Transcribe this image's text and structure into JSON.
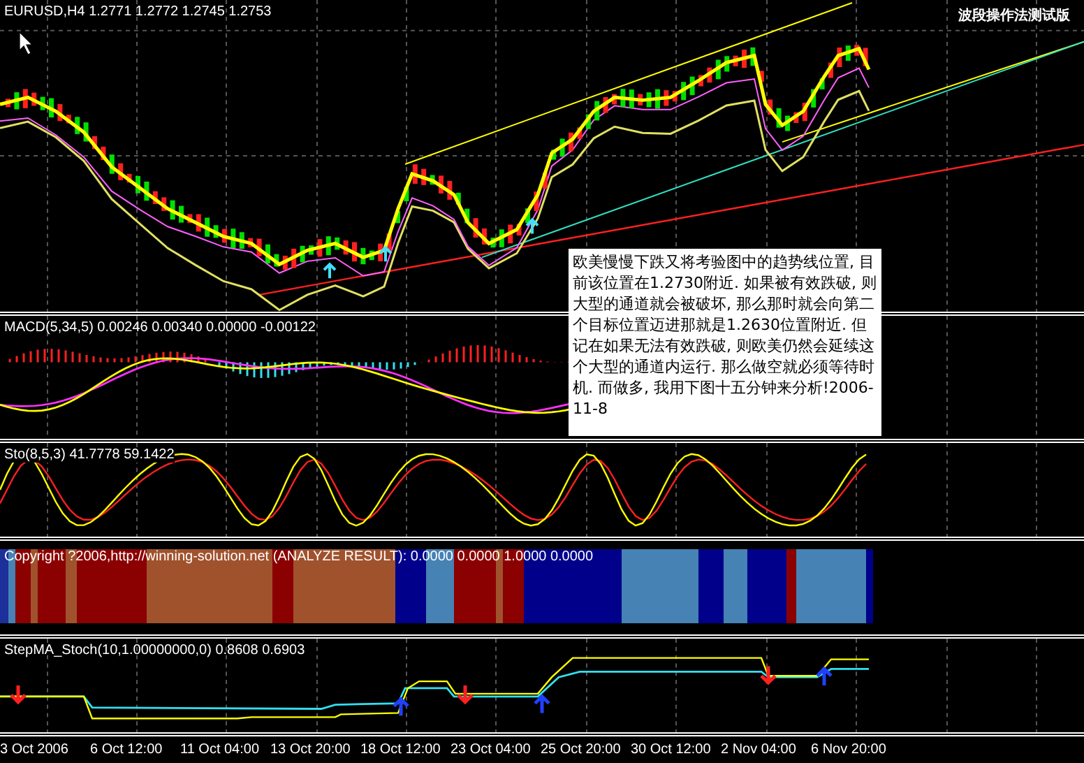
{
  "chart": {
    "symbol_label": "EURUSD,H4  1.2771 1.2772 1.2745 1.2753",
    "corner_label": "波段操作法测试版"
  },
  "annotation": {
    "text": "欧美慢慢下跌又将考验图中的趋势线位置, 目前该位置在1.2730附近. 如果被有效跌破, 则大型的通道就会被破坏, 那么那时就会向第二个目标位置迈进那就是1.2630位置附近. 但记在如果无法有效跌破, 则欧美仍然会延续这个大型的通道内运行. 那么做空就必须等待时机. 而做多, 我用下图十五分钟来分析!2006-11-8"
  },
  "panels": [
    {
      "kind": "macd",
      "label": "MACD(5,34,5) 0.00246 0.00340 0.00000 -0.00122"
    },
    {
      "kind": "stochastic",
      "label": "Sto(8,5,3) 41.7778 59.1422"
    },
    {
      "kind": "colorbar",
      "label": "Copyright ?2006,http://winning-solution.net (ANALYZE RESULT): 0.0000 0.0000 1.0000 0.0000",
      "segments": [
        {
          "color": "#1c2f9a"
        },
        {
          "color": "#4682b4"
        },
        {
          "color": "#8b0000"
        },
        {
          "color": "#a0522d"
        },
        {
          "color": "#8b0000"
        },
        {
          "color": "#a0522d"
        },
        {
          "color": "#8b0000"
        },
        {
          "color": "#a0522d"
        },
        {
          "color": "#8b0000"
        },
        {
          "color": "#a0522d"
        },
        {
          "color": "#00008b"
        },
        {
          "color": "#4682b4"
        },
        {
          "color": "#8b0000"
        },
        {
          "color": "#a0522d"
        },
        {
          "color": "#8b0000"
        },
        {
          "color": "#00008b"
        },
        {
          "color": "#4682b4"
        },
        {
          "color": "#00008b"
        },
        {
          "color": "#4682b4"
        },
        {
          "color": "#00008b"
        },
        {
          "color": "#8b0000"
        },
        {
          "color": "#4682b4"
        },
        {
          "color": "#00008b"
        }
      ]
    },
    {
      "kind": "stepma",
      "label": "StepMA_Stoch(10,1.00000000,0) 0.8608 0.6903"
    }
  ],
  "time_axis": [
    "3 Oct 2006",
    "6 Oct 12:00",
    "11 Oct 04:00",
    "13 Oct 20:00",
    "18 Oct 12:00",
    "23 Oct 04:00",
    "25 Oct 20:00",
    "30 Oct 12:00",
    "2 Nov 04:00",
    "6 Nov 20:00"
  ]
}
